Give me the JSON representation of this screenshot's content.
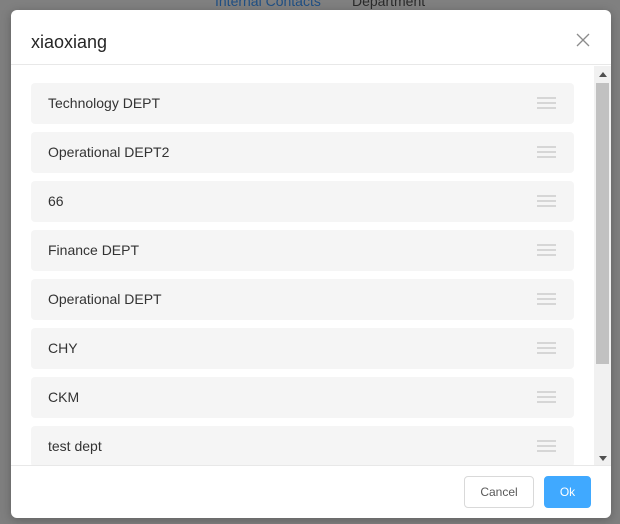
{
  "backdrop": {
    "tabs": [
      {
        "label": "Internal Contacts"
      },
      {
        "label": "Department"
      }
    ]
  },
  "modal": {
    "title": "xiaoxiang",
    "close_icon": "close-icon",
    "departments": [
      {
        "name": "Technology DEPT"
      },
      {
        "name": "Operational DEPT2"
      },
      {
        "name": "66"
      },
      {
        "name": "Finance DEPT"
      },
      {
        "name": "Operational DEPT"
      },
      {
        "name": "CHY"
      },
      {
        "name": "CKM"
      },
      {
        "name": "test dept"
      }
    ],
    "drag_icon": "drag-handle-icon",
    "cancel_label": "Cancel",
    "ok_label": "Ok"
  },
  "colors": {
    "primary": "#40a9ff",
    "item_bg": "#f5f5f5",
    "overlay": "#7f7f7f"
  }
}
